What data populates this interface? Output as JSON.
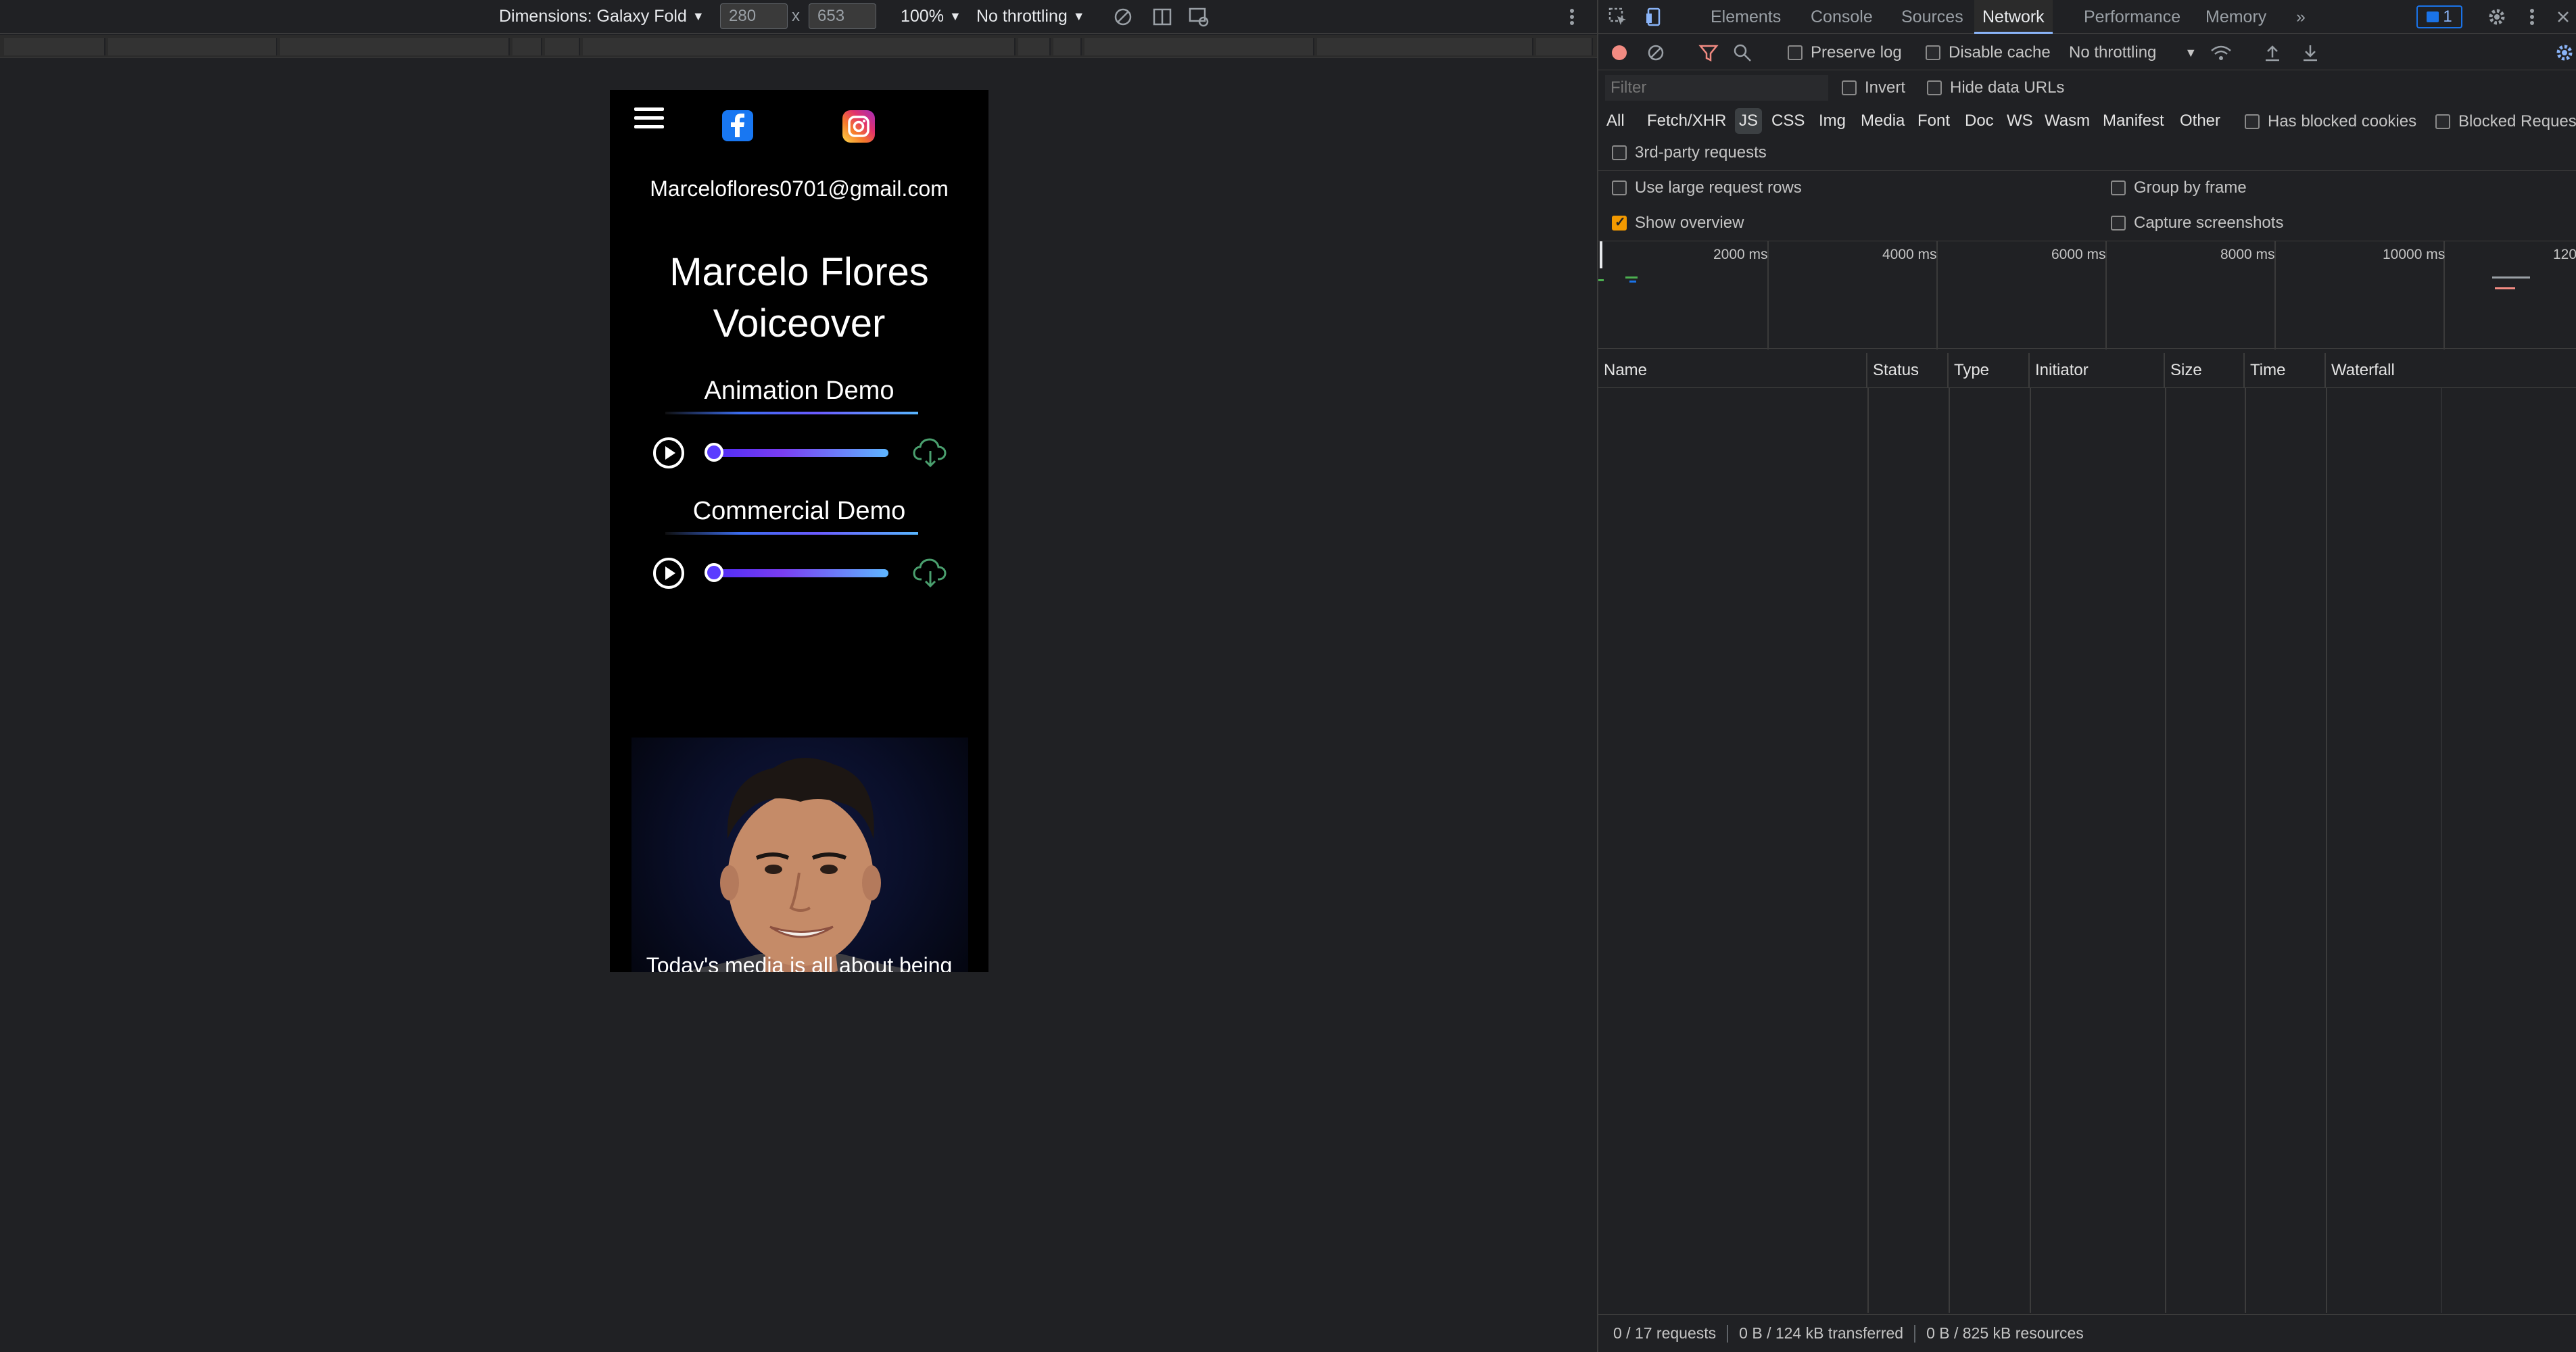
{
  "emulation_toolbar": {
    "dimensions_label": "Dimensions: Galaxy Fold",
    "width_value": "280",
    "height_value": "653",
    "times_symbol": "x",
    "zoom_label": "100%",
    "throttling_label": "No throttling"
  },
  "page": {
    "email": "Marceloflores0701@gmail.com",
    "title_line1": "Marcelo Flores",
    "title_line2": "Voiceover",
    "demos": [
      {
        "heading": "Animation Demo",
        "progress_fraction": 0.0
      },
      {
        "heading": "Commercial Demo",
        "progress_fraction": 0.0
      }
    ],
    "bio_text": "Today's media is all about being"
  },
  "devtools": {
    "tabs": [
      "Elements",
      "Console",
      "Sources",
      "Network",
      "Performance",
      "Memory"
    ],
    "active_tab": "Network",
    "more_tabs": "»",
    "issues_count": "1",
    "toolbar": {
      "preserve_log": "Preserve log",
      "disable_cache": "Disable cache",
      "throttling": "No throttling"
    },
    "filter": {
      "placeholder": "Filter",
      "invert": "Invert",
      "hide_data_urls": "Hide data URLs"
    },
    "type_filters": [
      "All",
      "Fetch/XHR",
      "JS",
      "CSS",
      "Img",
      "Media",
      "Font",
      "Doc",
      "WS",
      "Wasm",
      "Manifest",
      "Other"
    ],
    "active_type_filter": "JS",
    "has_blocked_cookies": "Has blocked cookies",
    "blocked_requests": "Blocked Requests",
    "third_party": "3rd-party requests",
    "use_large_rows": "Use large request rows",
    "group_by_frame": "Group by frame",
    "show_overview": "Show overview",
    "capture_screenshots": "Capture screenshots",
    "overview_ticks": [
      "2000 ms",
      "4000 ms",
      "6000 ms",
      "8000 ms",
      "10000 ms",
      "120"
    ],
    "columns": [
      "Name",
      "Status",
      "Type",
      "Initiator",
      "Size",
      "Time",
      "Waterfall"
    ],
    "status": {
      "requests": "0 / 17 requests",
      "transferred": "0 B / 124 kB transferred",
      "resources": "0 B / 825 kB resources"
    },
    "colors": {
      "accent": "#8ab4f8",
      "checkbox_on": "#f29900"
    }
  }
}
